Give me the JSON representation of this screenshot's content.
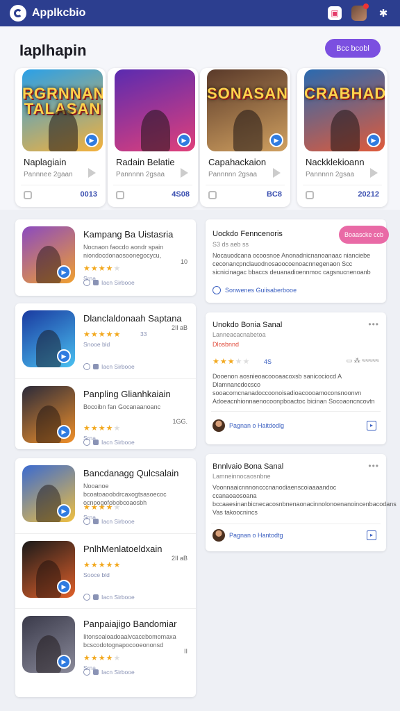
{
  "app": {
    "name": "Applkcbio"
  },
  "topbar": {
    "icons": [
      "app-store-icon",
      "avatar",
      "settings-icon"
    ]
  },
  "section": {
    "title": "Iaplhapin",
    "button_label": "Bcc bcobl"
  },
  "featured": [
    {
      "art_title": "RGRNNAN TALASAN",
      "title": "Naplagiain",
      "sub": "Pannnee 2gaan",
      "count": "0013",
      "colors": [
        "#2aa0e8",
        "#f5b13a"
      ]
    },
    {
      "art_title": "",
      "title": "Radain Belatie",
      "sub": "Pannnnn 2gsaa",
      "count": "4S08",
      "colors": [
        "#5a2bb0",
        "#e0407a"
      ]
    },
    {
      "art_title": "SONASAN",
      "title": "Capahackaion",
      "sub": "Pannnnn 2gsaa",
      "count": "BC8",
      "colors": [
        "#5a3a2a",
        "#d0a060"
      ]
    },
    {
      "art_title": "CRABHAD",
      "title": "Nackklekioann",
      "sub": "Pannnnn 2gsaa",
      "count": "20212",
      "colors": [
        "#2a6ab0",
        "#e05a3a"
      ]
    }
  ],
  "list_left": [
    {
      "title": "Kampang Ba Uistasria",
      "desc": "Nocnaon faocdo aondr spain niondocdonaosoonegocycu,",
      "stars": 4,
      "meta": "Srna",
      "right": "10",
      "foot": "Iacn  Sirbooe",
      "colors": [
        "#8a4ac0",
        "#f0a030"
      ]
    },
    {
      "title": "Dlanclaldonaah Saptana",
      "desc": "",
      "stars": 5,
      "meta": "Snooe bld",
      "right": "2Il aB",
      "rating": "33",
      "foot": "Iacn  Sirbooe",
      "colors": [
        "#1a3aa0",
        "#4ac0f0"
      ]
    },
    {
      "title": "Panpling Glianhkaiain",
      "desc": "Bocoibn fan Gocanaanoanc",
      "stars": 4,
      "meta": "Srna",
      "right": "1GG.",
      "foot": "Iacn  Sirbooe",
      "colors": [
        "#2a2a3a",
        "#f0902a"
      ]
    },
    {
      "title": "Bancdanagg Qulcsalain",
      "desc": "Nooanoe bcoatoaoobdrcaxogtsasoecoc ocnoogofobobcoaosbh",
      "stars": 4,
      "meta": "Srna",
      "right": "",
      "foot": "Iacn  Sirbooe",
      "colors": [
        "#3a6ad0",
        "#f0c040"
      ]
    },
    {
      "title": "PnlhMenlatoeldxain",
      "desc": "",
      "stars": 5,
      "meta": "Sooce bld",
      "right": "2Il aB",
      "foot": "Iacn  Sirbooe",
      "colors": [
        "#1a1a1a",
        "#e0602a"
      ]
    },
    {
      "title": "Panpaiajigo Bandomiar",
      "desc": "Iitonsoaloadoaalvcacebomomaxa bcscodotognapocooeononsd",
      "stars": 4,
      "meta": "Srna",
      "right": "II",
      "foot": "Iacn  Sirbooe",
      "colors": [
        "#3a3a4a",
        "#8a8a9a"
      ]
    }
  ],
  "right_cards": [
    {
      "title": "Uockdo Fenncenoris",
      "sub": "S3 ds aeb ss",
      "text": "Nocauodcana ocoosnoe Anonadnicnanoanaac nianciebe ceconancpnclauodnosaoocoenoacnnegenaon Scc sicnicinagac bbaccs deuanadioennmoc cagsnucnenoanb",
      "foot": "Sonwenes Guiisaberbooe",
      "pill": "Boaascke ccb"
    },
    {
      "title": "Unokdo Bonia Sanal",
      "sub": "Lanneacacnabetoa",
      "highlight": "Dlosbnnd",
      "text": "Dooenon aosnieoacoooaacoxsb sanicociocd A Dlamnancdocsco sooacomcnanadoccoonoisadioacoooamoconsnoonvn Adoeacnhionnaenocoonpboactoc bicinan Socoaoncncovtn",
      "rating": "4S",
      "foot": "Pagnan o Haitdodlg"
    },
    {
      "title": "Bnnlvaio Bona Sanal",
      "sub": "Lamneinnocaosnbne",
      "text": "Voonnaaicnnnoncccnanodiaenscoiaaaandoc ccanaoaosoana bccaaesinanbicnecacosnbnenaonacinnolonoenanoincenbacodans Vas takoocnincs",
      "foot": "Pagnan o Hantodtg"
    }
  ]
}
